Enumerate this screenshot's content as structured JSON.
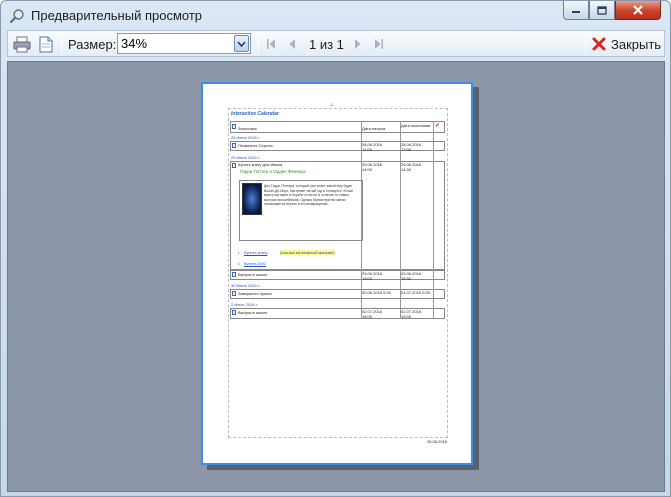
{
  "window": {
    "title": "Предварительный просмотр",
    "icon": "magnifier-icon",
    "controls": {
      "minimize": "minimize-icon",
      "maximize": "maximize-icon",
      "close": "close-icon"
    }
  },
  "toolbar": {
    "print_icon": "printer-icon",
    "page_setup_icon": "page-icon",
    "size_label": "Размер:",
    "size_value": "34%",
    "page_info": "1 из 1",
    "close_label": "Закрыть",
    "close_icon": "red-x-icon",
    "nav_icons": [
      "first-page-icon",
      "prev-page-icon",
      "next-page-icon",
      "last-page-icon"
    ]
  },
  "preview_page": {
    "page_number": "-1-",
    "title": "Interactive Calendar",
    "columns": [
      "Заголовок",
      "Дата начала",
      "Дата окончания"
    ],
    "groups": [
      {
        "label": "28 Июнь 2016 г.",
        "rows": [
          {
            "title": "Позвонить Сергею",
            "start": "28.06.2016 12:00",
            "end": "28.06.2016 13:00"
          }
        ]
      },
      {
        "label": "29 Июнь 2016 г.",
        "rows": [
          {
            "title": "Купить книгу для Ивана",
            "start": "29.06.2016 14:00",
            "end": "29.06.2016 14:30",
            "book_title": "Гарри Поттер и Орден Феникса",
            "description": "Для Гарри Поттера, который уже знает, какой ему будет Волан-Де-Морт, наступает пятый год в Хогвартсе. Юные маги участвуют в борьбе со злом, в отличие от самых могучих волшебников. Однако Министерство магии отказывается верить в его возвращение...",
            "link1": "Купить книгу",
            "link1_note": "(ссылка на книжный магазин)",
            "link2": "Купить DVD"
          },
          {
            "title": "Выпуск в школе",
            "start": "29.06.2016 19:00",
            "end": "29.06.2016 19:30"
          }
        ]
      },
      {
        "label": "30 Июнь 2016 г.",
        "rows": [
          {
            "title": "Завершить проект",
            "start": "30.06.2016 0:00",
            "end": "01.07.2016 0:00"
          }
        ]
      },
      {
        "label": "2 Июль 2016 г.",
        "rows": [
          {
            "title": "Выпуск в школе",
            "start": "02.07.2016 18:00",
            "end": "02.07.2016 19:00"
          }
        ]
      }
    ],
    "footer_date": "28.06.2016"
  }
}
